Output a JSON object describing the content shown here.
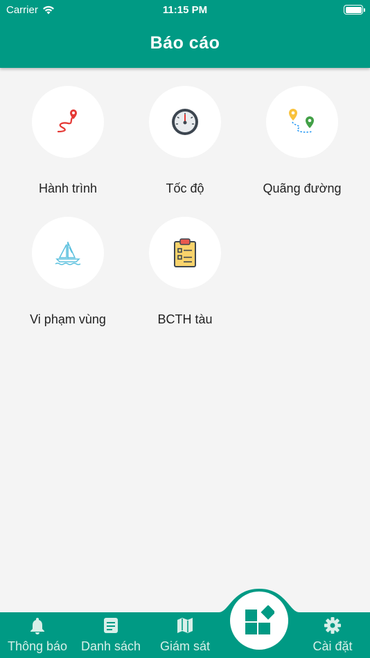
{
  "status_bar": {
    "carrier": "Carrier",
    "time": "11:15 PM"
  },
  "header": {
    "title": "Báo cáo"
  },
  "reports": [
    {
      "label": "Hành trình",
      "icon": "route-icon"
    },
    {
      "label": "Tốc độ",
      "icon": "speedometer-icon"
    },
    {
      "label": "Quãng đường",
      "icon": "distance-pins-icon"
    },
    {
      "label": "Vi phạm vùng",
      "icon": "sailboat-icon"
    },
    {
      "label": "BCTH tàu",
      "icon": "clipboard-icon"
    }
  ],
  "nav": {
    "notifications": "Thông báo",
    "list": "Danh sách",
    "monitor": "Giám sát",
    "settings": "Cài đặt"
  },
  "colors": {
    "primary": "#009a84",
    "background": "#f4f4f4"
  }
}
